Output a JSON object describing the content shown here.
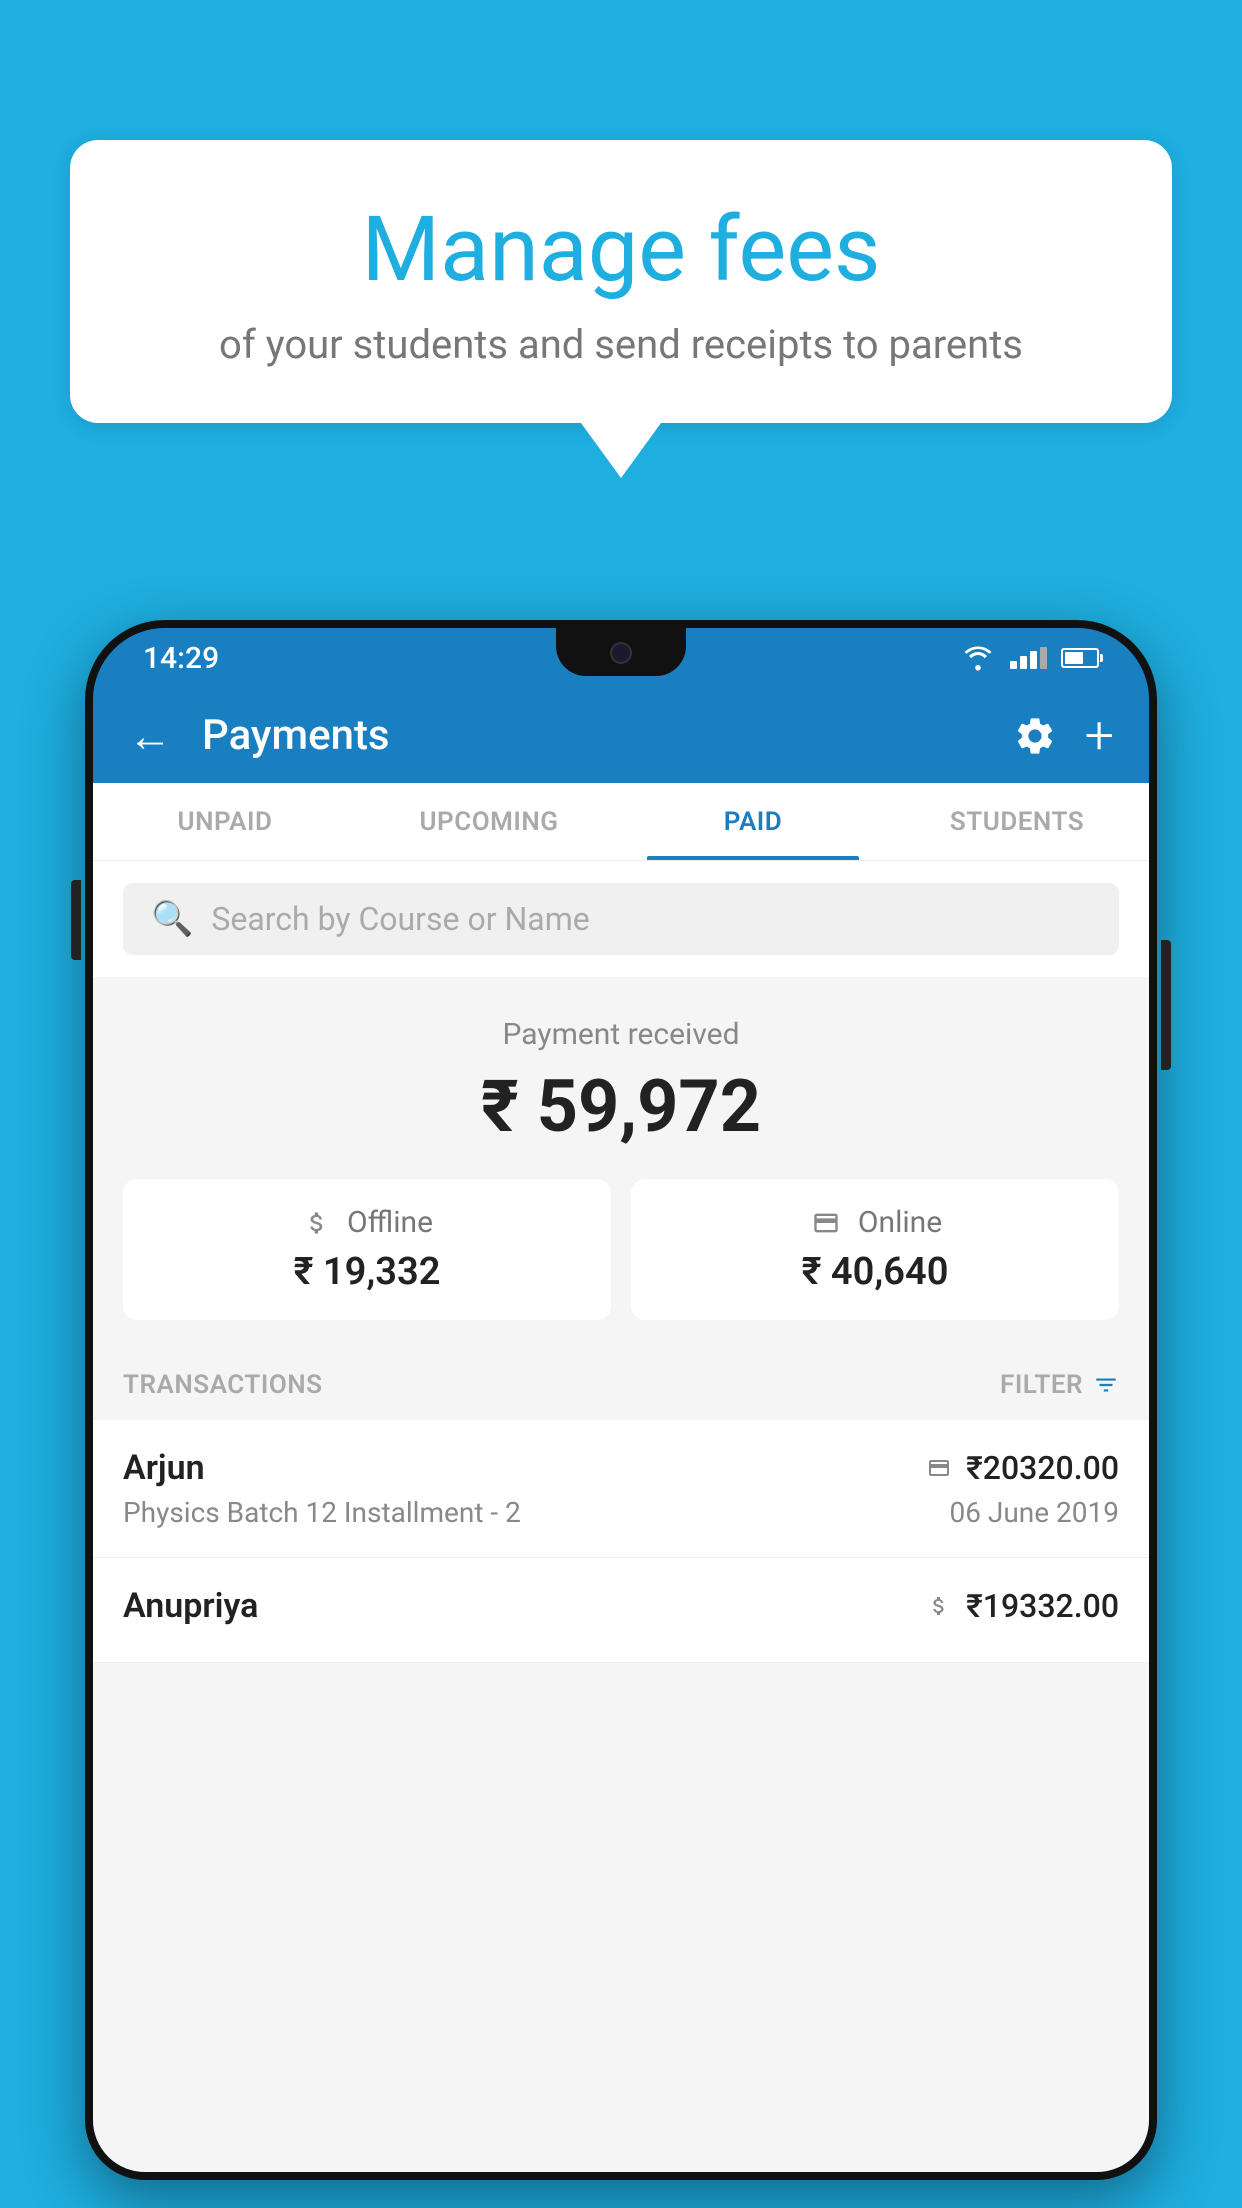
{
  "background_color": "#1EAEE0",
  "speech_bubble": {
    "title": "Manage fees",
    "subtitle": "of your students and send receipts to parents"
  },
  "phone": {
    "status_bar": {
      "time": "14:29"
    },
    "app_bar": {
      "title": "Payments",
      "back_icon": "←",
      "plus_icon": "+"
    },
    "tabs": [
      {
        "label": "UNPAID",
        "active": false
      },
      {
        "label": "UPCOMING",
        "active": false
      },
      {
        "label": "PAID",
        "active": true
      },
      {
        "label": "STUDENTS",
        "active": false
      }
    ],
    "search": {
      "placeholder": "Search by Course or Name"
    },
    "payment_summary": {
      "label": "Payment received",
      "amount": "₹ 59,972",
      "offline_label": "Offline",
      "offline_amount": "₹ 19,332",
      "online_label": "Online",
      "online_amount": "₹ 40,640"
    },
    "transactions": {
      "label": "TRANSACTIONS",
      "filter_label": "FILTER",
      "items": [
        {
          "name": "Arjun",
          "detail": "Physics Batch 12 Installment - 2",
          "amount": "₹20320.00",
          "date": "06 June 2019",
          "type": "online"
        },
        {
          "name": "Anupriya",
          "detail": "",
          "amount": "₹19332.00",
          "date": "",
          "type": "offline"
        }
      ]
    }
  }
}
